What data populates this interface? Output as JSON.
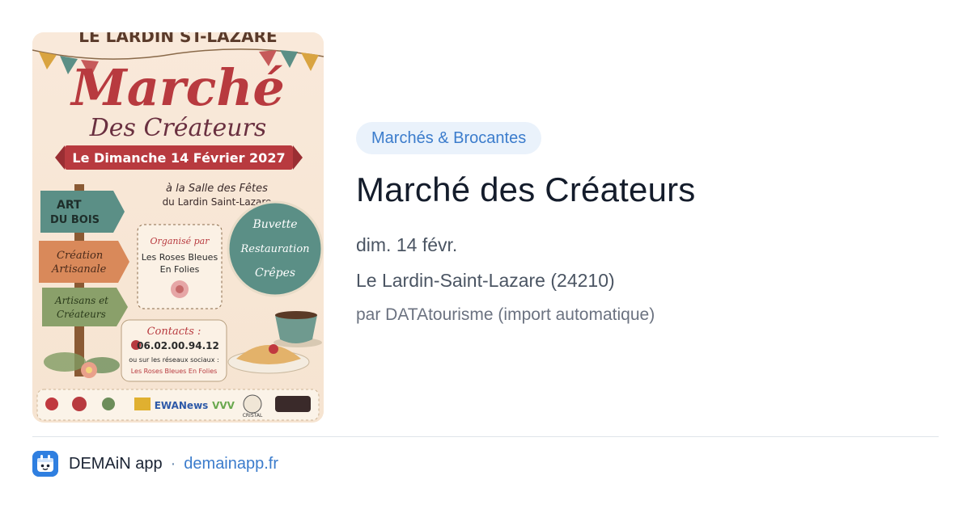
{
  "poster": {
    "header": "LE LARDIN ST-LAZARE",
    "title_main": "Marché",
    "title_sub": "Des Créateurs",
    "date_banner": "Le Dimanche 14 Février 2027",
    "venue_line1": "à la Salle des Fêtes",
    "venue_line2": "du Lardin Saint-Lazare",
    "sign1_line1": "ART",
    "sign1_line2": "DU BOIS",
    "sign2_line1": "Création",
    "sign2_line2": "Artisanale",
    "sign3_line1": "Artisans et",
    "sign3_line2": "Créateurs",
    "organizer_label": "Organisé par",
    "organizer_line1": "Les Roses Bleues",
    "organizer_line2": "En Folies",
    "circle_line1": "Buvette",
    "circle_line2": "Restauration",
    "circle_line3": "Crêpes",
    "contacts_label": "Contacts :",
    "phone": "06.02.00.94.12",
    "social_line": "ou sur les réseaux sociaux :",
    "social_name": "Les Roses Bleues En Folies",
    "sponsor_ewa": "EWANews",
    "sponsor_cristal": "CRISTAL"
  },
  "event": {
    "category": "Marchés & Brocantes",
    "title": "Marché des Créateurs",
    "date": "dim. 14 févr.",
    "location": "Le Lardin-Saint-Lazare (24210)",
    "source": "par DATAtourisme (import automatique)"
  },
  "footer": {
    "app_name": "DEMAiN app",
    "separator": "·",
    "domain": "demainapp.fr"
  },
  "colors": {
    "accent": "#3b7ccc",
    "badge_bg": "#eaf2fb",
    "poster_red": "#b83a3f",
    "poster_teal": "#5b8f86",
    "poster_green": "#6c8d5a"
  }
}
